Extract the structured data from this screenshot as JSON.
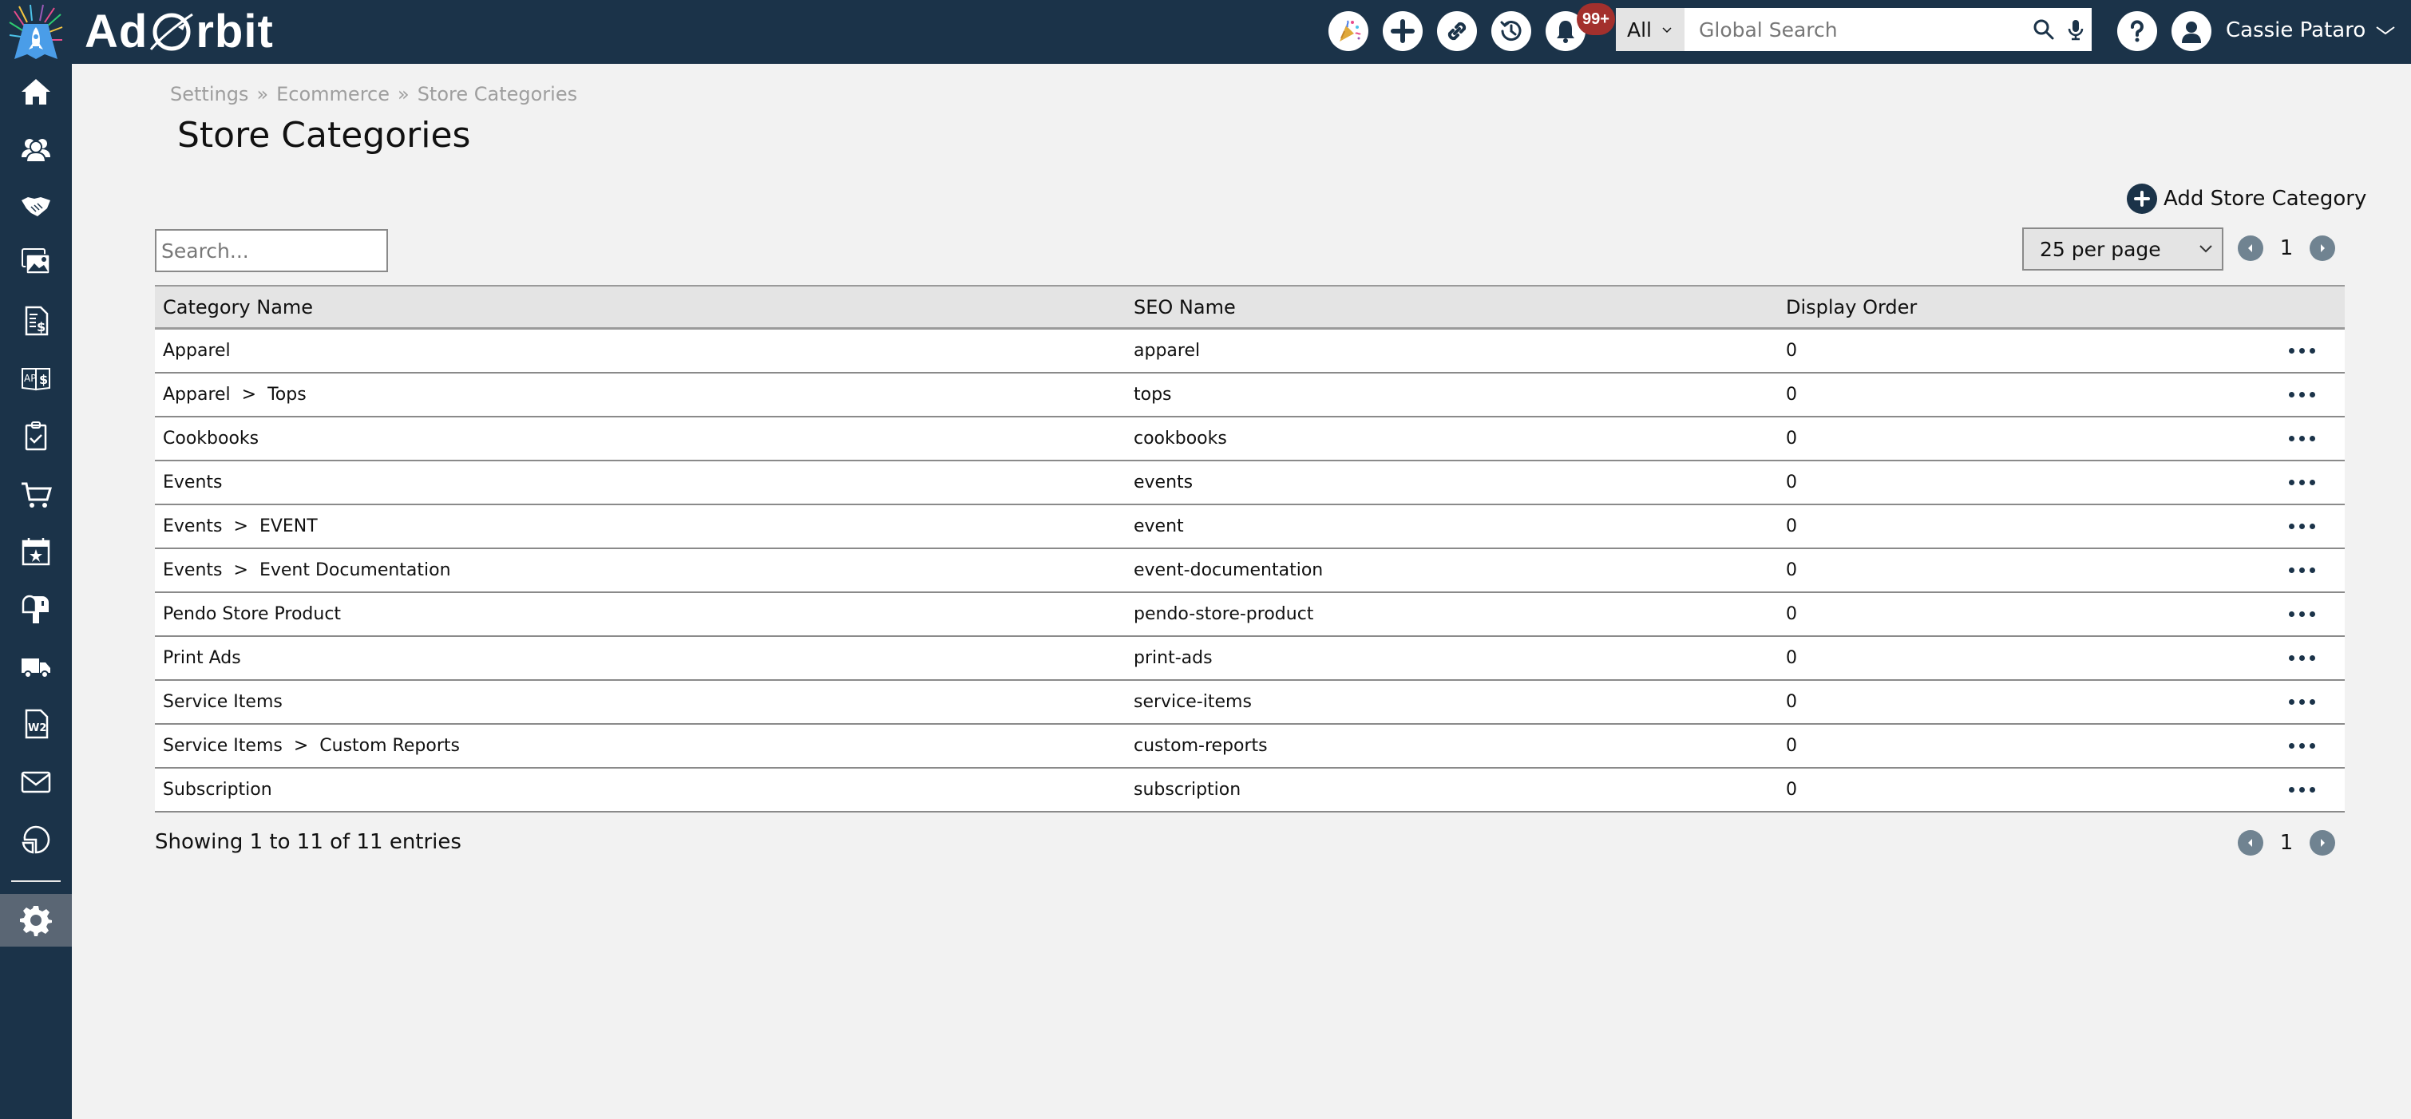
{
  "app": {
    "brand_prefix": "Ad",
    "brand_suffix": "rbit"
  },
  "header": {
    "icons": [
      "party-popper-icon",
      "plus-circle-icon",
      "link-icon",
      "history-icon",
      "bell-icon"
    ],
    "notification_badge": "99+",
    "search": {
      "scope": "All",
      "placeholder": "Global Search"
    },
    "user_name": "Cassie Pataro"
  },
  "sidebar": {
    "items": [
      {
        "name": "home"
      },
      {
        "name": "contacts"
      },
      {
        "name": "deals"
      },
      {
        "name": "media"
      },
      {
        "name": "invoices"
      },
      {
        "name": "accounting"
      },
      {
        "name": "tasks"
      },
      {
        "name": "ecommerce"
      },
      {
        "name": "events"
      },
      {
        "name": "mailbox"
      },
      {
        "name": "delivery"
      },
      {
        "name": "w2"
      },
      {
        "name": "email"
      },
      {
        "name": "reports"
      },
      {
        "name": "settings",
        "active": true
      }
    ]
  },
  "breadcrumb": [
    "Settings",
    "Ecommerce",
    "Store Categories"
  ],
  "breadcrumb_sep": "»",
  "page_title": "Store Categories",
  "actions": {
    "add_label": "Add Store Category"
  },
  "table_controls": {
    "search_placeholder": "Search...",
    "per_page": "25 per page",
    "current_page": "1"
  },
  "table": {
    "columns": [
      "Category Name",
      "SEO Name",
      "Display Order",
      ""
    ],
    "rows": [
      {
        "category": [
          "Apparel"
        ],
        "seo": "apparel",
        "order": "0"
      },
      {
        "category": [
          "Apparel",
          "Tops"
        ],
        "seo": "tops",
        "order": "0"
      },
      {
        "category": [
          "Cookbooks"
        ],
        "seo": "cookbooks",
        "order": "0"
      },
      {
        "category": [
          "Events"
        ],
        "seo": "events",
        "order": "0"
      },
      {
        "category": [
          "Events",
          "EVENT"
        ],
        "seo": "event",
        "order": "0"
      },
      {
        "category": [
          "Events",
          "Event Documentation"
        ],
        "seo": "event-documentation",
        "order": "0"
      },
      {
        "category": [
          "Pendo Store Product"
        ],
        "seo": "pendo-store-product",
        "order": "0"
      },
      {
        "category": [
          "Print Ads"
        ],
        "seo": "print-ads",
        "order": "0"
      },
      {
        "category": [
          "Service Items"
        ],
        "seo": "service-items",
        "order": "0"
      },
      {
        "category": [
          "Service Items",
          "Custom Reports"
        ],
        "seo": "custom-reports",
        "order": "0"
      },
      {
        "category": [
          "Subscription"
        ],
        "seo": "subscription",
        "order": "0"
      }
    ],
    "category_sep": ">"
  },
  "footer": {
    "entries_text": "Showing 1 to 11 of 11 entries",
    "current_page": "1"
  },
  "colors": {
    "navy": "#1b3349",
    "badge_red": "#a3302d",
    "pager_gray": "#708391",
    "sidebar_active": "#5a6674"
  }
}
